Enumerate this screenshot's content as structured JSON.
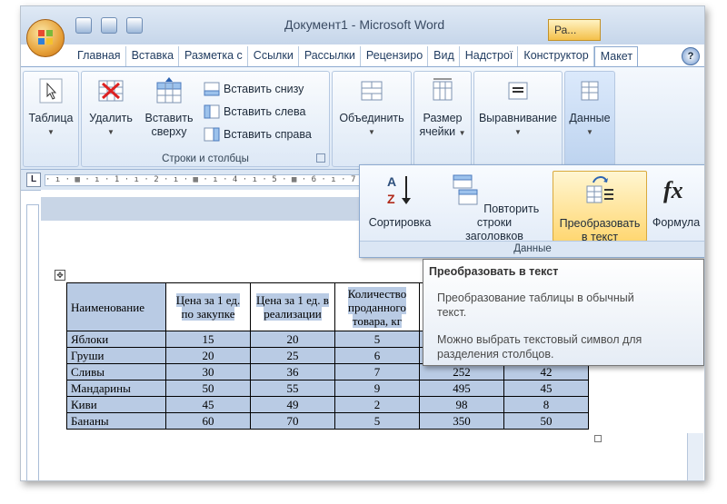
{
  "window": {
    "title": "Документ1 - Microsoft Word",
    "context_tab": "Ра..."
  },
  "tabs": [
    "Главная",
    "Вставка",
    "Разметка с",
    "Ссылки",
    "Рассылки",
    "Рецензиро",
    "Вид",
    "Надстрої",
    "Конструктор",
    "Макет"
  ],
  "active_tab": "Макет",
  "help": "?",
  "ribbon": {
    "table_btn": "Таблица",
    "delete_btn": "Удалить",
    "insert_above_btn_1": "Вставить",
    "insert_above_btn_2": "сверху",
    "insert_below": "Вставить снизу",
    "insert_left": "Вставить слева",
    "insert_right": "Вставить справа",
    "rows_cols_group": "Строки и столбцы",
    "merge_btn": "Объединить",
    "cell_size_btn_1": "Размер",
    "cell_size_btn_2": "ячейки",
    "align_btn": "Выравнивание",
    "data_btn": "Данные"
  },
  "ruler": {
    "corner": "L",
    "ticks": "· ı · ▦ · ı · 1 · ı · 2 · ı · ▦ · ı · 4 · ı · 5 · ▦ · 6 · ı · 7 · ı · ▦"
  },
  "data_panel": {
    "sort_label": "Сортировка",
    "repeat_header_1": "Повторить строки",
    "repeat_header_2": "заголовков",
    "convert_1": "Преобразовать",
    "convert_2": "в текст",
    "formula_label": "Формула",
    "group_label": "Данные"
  },
  "tooltip": {
    "title": "Преобразовать в текст",
    "line1": "Преобразование таблицы в обычный",
    "line2": "текст.",
    "line3": "Можно выбрать текстовый символ для",
    "line4": "разделения столбцов."
  },
  "table": {
    "headers": [
      "Наименование",
      "Цена за 1 ед. по закупке",
      "Цена за 1 ед. в реализации",
      "Количество проданного товара, кг"
    ],
    "rows": [
      [
        "Яблоки",
        "15",
        "20",
        "5",
        "",
        ""
      ],
      [
        "Груши",
        "20",
        "25",
        "6",
        "",
        ""
      ],
      [
        "Сливы",
        "30",
        "36",
        "7",
        "252",
        "42"
      ],
      [
        "Мандарины",
        "50",
        "55",
        "9",
        "495",
        "45"
      ],
      [
        "Киви",
        "45",
        "49",
        "2",
        "98",
        "8"
      ],
      [
        "Бананы",
        "60",
        "70",
        "5",
        "350",
        "50"
      ]
    ]
  },
  "colors": {
    "selection": "#b9cbe4",
    "ribbon_bg": "#dbe7f5",
    "highlight": "#ffd772"
  }
}
